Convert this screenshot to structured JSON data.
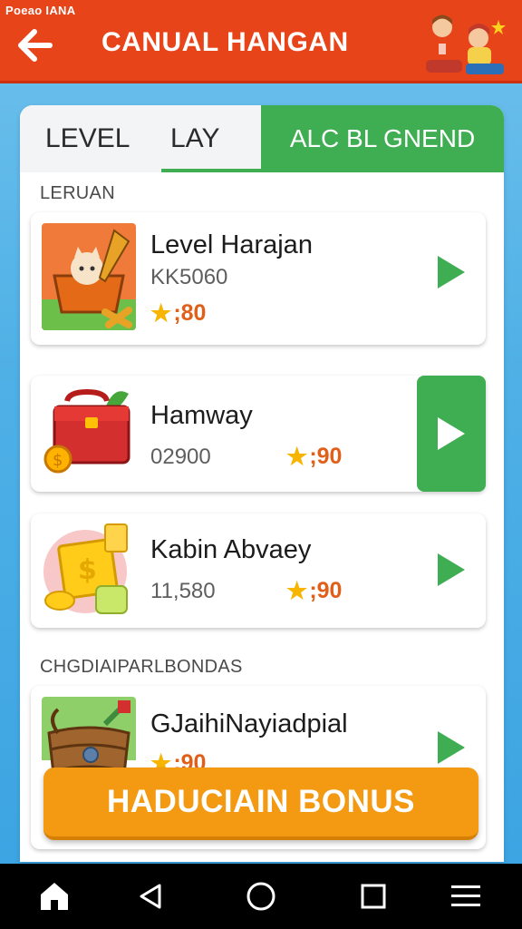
{
  "status_bar": {
    "text": "Poeao IANA"
  },
  "header": {
    "title": "CANUAL HANGAN",
    "back_icon": "arrow-left-icon",
    "mascot_icon": "kids-mascot-icon"
  },
  "tabs": [
    {
      "label": "LEVEL",
      "active": false
    },
    {
      "label": "LAY",
      "active": false
    },
    {
      "label": "ALC BL GNEND",
      "active": true
    }
  ],
  "sections": [
    {
      "label": "LERUAN"
    },
    {
      "label": "CHGDIAIPARLBONDAS"
    }
  ],
  "levels": [
    {
      "title": "Level Harajan",
      "count": "KK5060",
      "stars": ";80",
      "thumb_icon": "cat-basket-icon",
      "play_icon": "play-icon"
    },
    {
      "title": "Hamway",
      "count": "02900",
      "stars": ";90",
      "thumb_icon": "red-toolbox-icon",
      "play_icon": "play-icon"
    },
    {
      "title": "Kabin Abvaey",
      "count": "11,580",
      "stars": ";90",
      "thumb_icon": "gold-coins-icon",
      "play_icon": "play-icon"
    },
    {
      "title": "GJaihiNayiadpial",
      "count": "",
      "stars": ";90",
      "thumb_icon": "wooden-barrel-icon",
      "play_icon": "play-icon"
    }
  ],
  "bonus_button": {
    "label": "HADUCIAIN BONUS"
  },
  "nav": {
    "home_icon": "home-icon",
    "back_icon": "triangle-back-icon",
    "circle_icon": "circle-home-icon",
    "square_icon": "square-recents-icon",
    "menu_icon": "menu-icon"
  },
  "colors": {
    "header": "#e8441a",
    "accent_green": "#3fae52",
    "bonus_orange": "#f39a12",
    "stars_orange": "#e0601a"
  }
}
